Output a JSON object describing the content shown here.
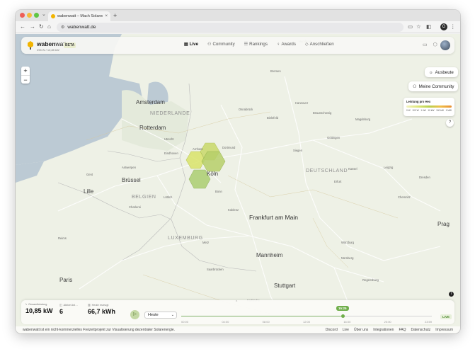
{
  "browser": {
    "tab_title": "wabenwatt – Mach Solarenergie",
    "url": "wabenwatt.de"
  },
  "header": {
    "brand_prefix": "waben",
    "brand_suffix": "watt",
    "beta": "BETA",
    "brand_sub": "295 W / 10,85 kW",
    "menu": [
      {
        "label": "Live",
        "icon": "map-icon"
      },
      {
        "label": "Community",
        "icon": "users-icon"
      },
      {
        "label": "Rankings",
        "icon": "chart-icon"
      },
      {
        "label": "Awards",
        "icon": "award-icon"
      },
      {
        "label": "Anschließen",
        "icon": "plug-icon"
      }
    ]
  },
  "map_controls": {
    "zoom_in": "+",
    "zoom_out": "−",
    "ausbeute": "Ausbeute",
    "community": "Meine Community"
  },
  "legend": {
    "title": "Leistung pro Hex",
    "labels": [
      "0 W",
      "100 W",
      "1 kW",
      "10 kW",
      "100 kW",
      "1 MW"
    ]
  },
  "map_labels": [
    {
      "text": "Amsterdam",
      "cls": "city"
    },
    {
      "text": "NIEDERLANDE",
      "cls": "country"
    },
    {
      "text": "Rotterdam",
      "cls": "city"
    },
    {
      "text": "Brüssel",
      "cls": "city"
    },
    {
      "text": "BELGIEN",
      "cls": "country"
    },
    {
      "text": "Lille",
      "cls": "city"
    },
    {
      "text": "LUXEMBURG",
      "cls": "country"
    },
    {
      "text": "Paris",
      "cls": "city"
    },
    {
      "text": "Dortmund",
      "cls": "town"
    },
    {
      "text": "Köln",
      "cls": "city"
    },
    {
      "text": "DEUTSCHLAND",
      "cls": "country"
    },
    {
      "text": "Frankfurt am Main",
      "cls": "bigcity"
    },
    {
      "text": "Mannheim",
      "cls": "city"
    },
    {
      "text": "Stuttgart",
      "cls": "city"
    },
    {
      "text": "Prag",
      "cls": "city"
    },
    {
      "text": "Hannover",
      "cls": "town"
    },
    {
      "text": "Bremen",
      "cls": "town"
    },
    {
      "text": "Eindhoven",
      "cls": "town"
    },
    {
      "text": "Antwerpen",
      "cls": "town"
    },
    {
      "text": "Lüttich",
      "cls": "town"
    },
    {
      "text": "Bonn",
      "cls": "town"
    },
    {
      "text": "Kassel",
      "cls": "town"
    },
    {
      "text": "Nürnberg",
      "cls": "town"
    },
    {
      "text": "Dresden",
      "cls": "town"
    },
    {
      "text": "Erfurt",
      "cls": "town"
    },
    {
      "text": "Bielefeld",
      "cls": "town"
    },
    {
      "text": "Osnabrück",
      "cls": "town"
    },
    {
      "text": "Magdeburg",
      "cls": "town"
    },
    {
      "text": "Saarbrücken",
      "cls": "town"
    },
    {
      "text": "Würzburg",
      "cls": "town"
    },
    {
      "text": "Regensburg",
      "cls": "town"
    },
    {
      "text": "Leipzig",
      "cls": "town"
    },
    {
      "text": "Chemnitz",
      "cls": "town"
    },
    {
      "text": "Siegen",
      "cls": "town"
    },
    {
      "text": "Koblenz",
      "cls": "town"
    },
    {
      "text": "Göttingen",
      "cls": "town"
    },
    {
      "text": "Braunschweig",
      "cls": "town"
    },
    {
      "text": "Karlsruhe",
      "cls": "town"
    },
    {
      "text": "Reims",
      "cls": "town"
    },
    {
      "text": "Metz",
      "cls": "town"
    },
    {
      "text": "Charleroi",
      "cls": "town"
    },
    {
      "text": "Gent",
      "cls": "town"
    },
    {
      "text": "Utrecht",
      "cls": "town"
    },
    {
      "text": "Arnhem",
      "cls": "town"
    },
    {
      "text": "Hamburg",
      "cls": "town"
    }
  ],
  "stats": [
    {
      "label": "Gesamtleistung",
      "value": "10,85 kW"
    },
    {
      "label": "Aktive Anl…",
      "value": "6"
    },
    {
      "label": "Heute erzeugt",
      "value": "66,7 kWh"
    }
  ],
  "timeline": {
    "select": "Heute",
    "current": "15:25",
    "progress": 0.645,
    "ticks": [
      "00:00",
      "04:00",
      "08:00",
      "12:00",
      "16:00",
      "20:00",
      "23:59"
    ],
    "live": "LIVE"
  },
  "footer": {
    "text": "wabenwatt ist ein nicht-kommerzielles Freizeitprojekt zur Visualisierung dezentraler Solarenergie.",
    "links": [
      "Discord",
      "Live",
      "Über uns",
      "Integrationen",
      "FAQ",
      "Datenschutz",
      "Impressum"
    ]
  },
  "colors": {
    "accent": "#6fae4a",
    "hex_yellow": "#d9e46a",
    "hex_green": "#a8cc6a"
  }
}
